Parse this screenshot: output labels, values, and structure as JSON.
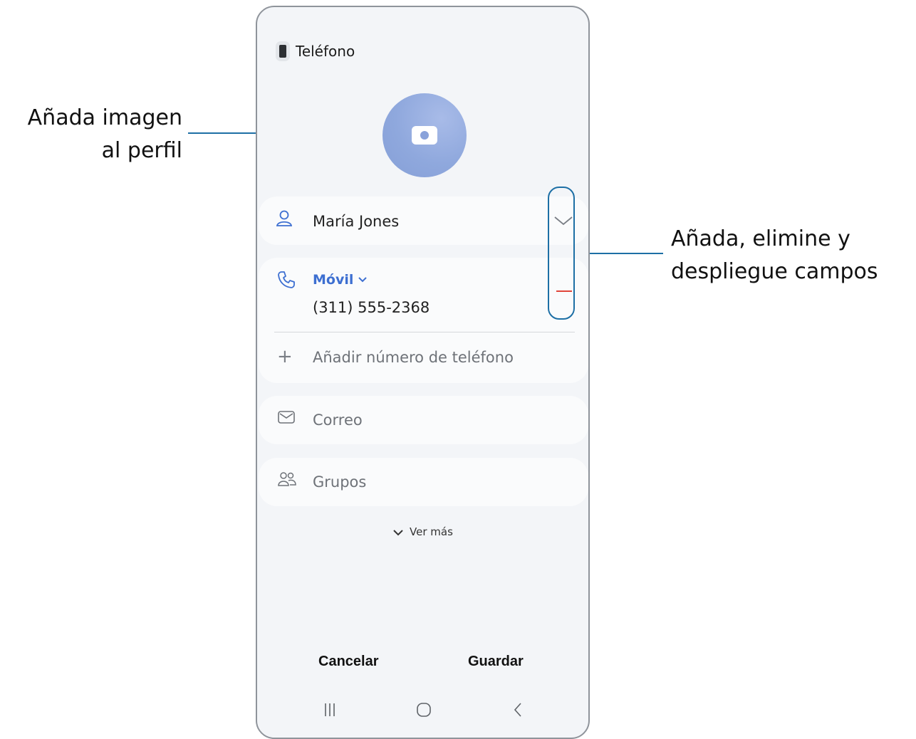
{
  "callouts": {
    "profile_image": [
      "Añada imagen",
      "al perfil"
    ],
    "fields": [
      "Añada, elimine y",
      "despliegue campos"
    ]
  },
  "account": {
    "label": "Teléfono"
  },
  "name_field": {
    "value": "María Jones"
  },
  "phone_field": {
    "type_label": "Móvil",
    "value": "(311) 555-2368"
  },
  "add_phone": {
    "placeholder": "Añadir número de teléfono"
  },
  "email_field": {
    "placeholder": "Correo"
  },
  "groups_field": {
    "placeholder": "Grupos"
  },
  "more": {
    "label": "Ver más"
  },
  "actions": {
    "cancel": "Cancelar",
    "save": "Guardar"
  },
  "colors": {
    "accent": "#3d6fd1",
    "remove": "#e0453a",
    "callout_line": "#1d6fa5",
    "avatar": "#8fa8dd"
  },
  "icons": [
    "phone-account-icon",
    "camera-icon",
    "person-icon",
    "expand-chevron-icon",
    "call-icon",
    "remove-field-icon",
    "plus-icon",
    "mail-icon",
    "groups-icon",
    "chevron-down-icon",
    "recents-nav-icon",
    "home-nav-icon",
    "back-nav-icon"
  ]
}
